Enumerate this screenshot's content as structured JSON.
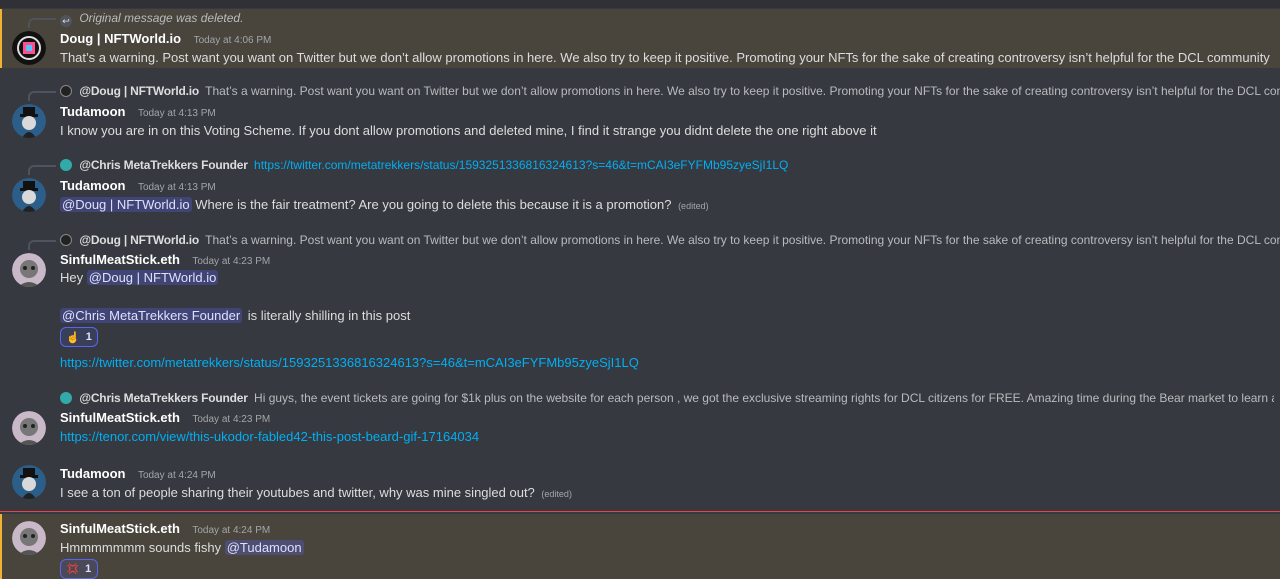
{
  "colors": {
    "background": "#36393f",
    "highlight": "#49443c",
    "mention": "#5865f2",
    "link": "#00aff4",
    "new_divider": "#ed4245"
  },
  "messages": [
    {
      "reply": {
        "deleted_text": "Original message was deleted."
      },
      "author": "Doug | NFTWorld.io",
      "timestamp": "Today at 4:06 PM",
      "text": "That’s a warning. Post want you want on Twitter but we don’t allow promotions in here. We also try to keep it positive. Promoting your NFTs for the sake of creating controversy isn’t helpful for the DCL community"
    },
    {
      "reply": {
        "name": "@Doug | NFTWorld.io",
        "text": "That’s a warning. Post want you want on Twitter but we don’t allow promotions in here. We also try to keep it positive. Promoting your NFTs for the sake of creating controversy isn’t helpful for the DCL community"
      },
      "author": "Tudamoon",
      "timestamp": "Today at 4:13 PM",
      "text": "I know you are in on this Voting Scheme. If you dont allow promotions and deleted mine, I find it strange you didnt delete the one right above it"
    },
    {
      "reply": {
        "name": "@Chris MetaTrekkers Founder",
        "link": "https://twitter.com/metatrekkers/status/1593251336816324613?s=46&t=mCAI3eFYFMb95zyeSjI1LQ"
      },
      "author": "Tudamoon",
      "timestamp": "Today at 4:13 PM",
      "mention": "@Doug | NFTWorld.io",
      "text": "Where is the fair treatment? Are you going to delete this because it is a promotion?",
      "edited": "(edited)"
    },
    {
      "reply": {
        "name": "@Doug | NFTWorld.io",
        "text": "That’s a warning. Post want you want on Twitter but we don’t allow promotions in here. We also try to keep it positive. Promoting your NFTs for the sake of creating controversy isn’t helpful for the DCL community"
      },
      "author": "SinfulMeatStick.eth",
      "timestamp": "Today at 4:23 PM",
      "line1_prefix": "Hey",
      "line1_mention": "@Doug | NFTWorld.io",
      "line2_mention": "@Chris MetaTrekkers Founder",
      "line2_text": "is literally shilling in this post",
      "reaction": {
        "emoji": "☝",
        "count": "1"
      },
      "link": "https://twitter.com/metatrekkers/status/1593251336816324613?s=46&t=mCAI3eFYFMb95zyeSjI1LQ"
    },
    {
      "reply": {
        "name": "@Chris MetaTrekkers Founder",
        "text": "Hi guys, the event tickets are going for $1k plus on the website for each person , we got the exclusive streaming rights for DCL citizens for FREE. Amazing time during the Bear market to learn about what the policy ..."
      },
      "author": "SinfulMeatStick.eth",
      "timestamp": "Today at 4:23 PM",
      "link": "https://tenor.com/view/this-ukodor-fabled42-this-post-beard-gif-17164034"
    },
    {
      "author": "Tudamoon",
      "timestamp": "Today at 4:24 PM",
      "text": "I see a ton of people sharing their youtubes and twitter, why was mine singled out?",
      "edited": "(edited)"
    },
    {
      "author": "SinfulMeatStick.eth",
      "timestamp": "Today at 4:24 PM",
      "text": "Hmmmmmmm sounds fishy",
      "mention": "@Tudamoon",
      "reaction": {
        "emoji": "💢",
        "count": "1"
      }
    }
  ]
}
